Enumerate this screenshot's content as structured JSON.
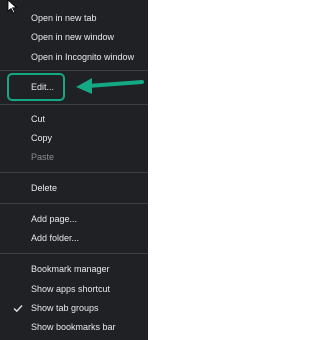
{
  "menu": {
    "groups": [
      {
        "items": [
          {
            "label": "Open in new tab",
            "enabled": true
          },
          {
            "label": "Open in new window",
            "enabled": true
          },
          {
            "label": "Open in Incognito window",
            "enabled": true
          }
        ]
      },
      {
        "items": [
          {
            "label": "Edit...",
            "enabled": true,
            "highlighted": true
          }
        ]
      },
      {
        "items": [
          {
            "label": "Cut",
            "enabled": true
          },
          {
            "label": "Copy",
            "enabled": true
          },
          {
            "label": "Paste",
            "enabled": false
          }
        ]
      },
      {
        "items": [
          {
            "label": "Delete",
            "enabled": true
          }
        ]
      },
      {
        "items": [
          {
            "label": "Add page...",
            "enabled": true
          },
          {
            "label": "Add folder...",
            "enabled": true
          }
        ]
      },
      {
        "items": [
          {
            "label": "Bookmark manager",
            "enabled": true
          },
          {
            "label": "Show apps shortcut",
            "enabled": true
          },
          {
            "label": "Show tab groups",
            "enabled": true,
            "checked": true
          },
          {
            "label": "Show bookmarks bar",
            "enabled": true
          }
        ]
      }
    ]
  },
  "annotation": {
    "highlight_color": "#14a884",
    "arrow_color": "#14a884",
    "arrow_icon": "left-arrow-icon"
  },
  "colors": {
    "menu_background": "#202124",
    "text": "#e8eaed",
    "disabled_text": "#8a8c90",
    "separator": "#3c4043"
  }
}
